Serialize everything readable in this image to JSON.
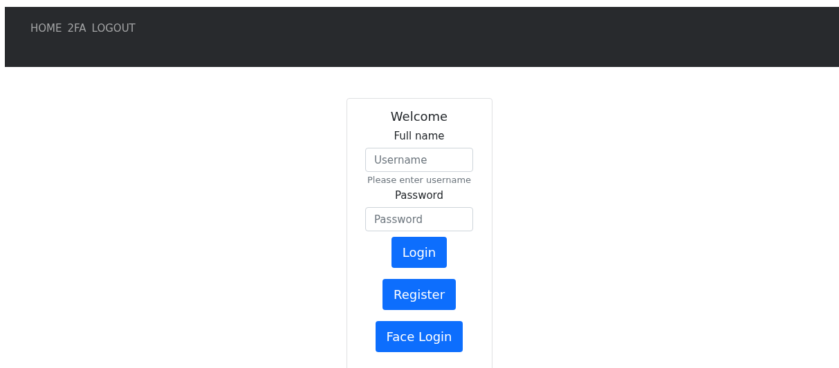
{
  "navbar": {
    "links": [
      {
        "label": "HOME"
      },
      {
        "label": "2FA"
      },
      {
        "label": "LOGOUT"
      }
    ]
  },
  "login_card": {
    "title": "Welcome",
    "fields": [
      {
        "label": "Full name",
        "placeholder": "Username",
        "help": "Please enter username"
      },
      {
        "label": "Password",
        "placeholder": "Password"
      }
    ],
    "buttons": [
      {
        "label": "Login"
      },
      {
        "label": "Register"
      },
      {
        "label": "Face Login"
      }
    ]
  }
}
